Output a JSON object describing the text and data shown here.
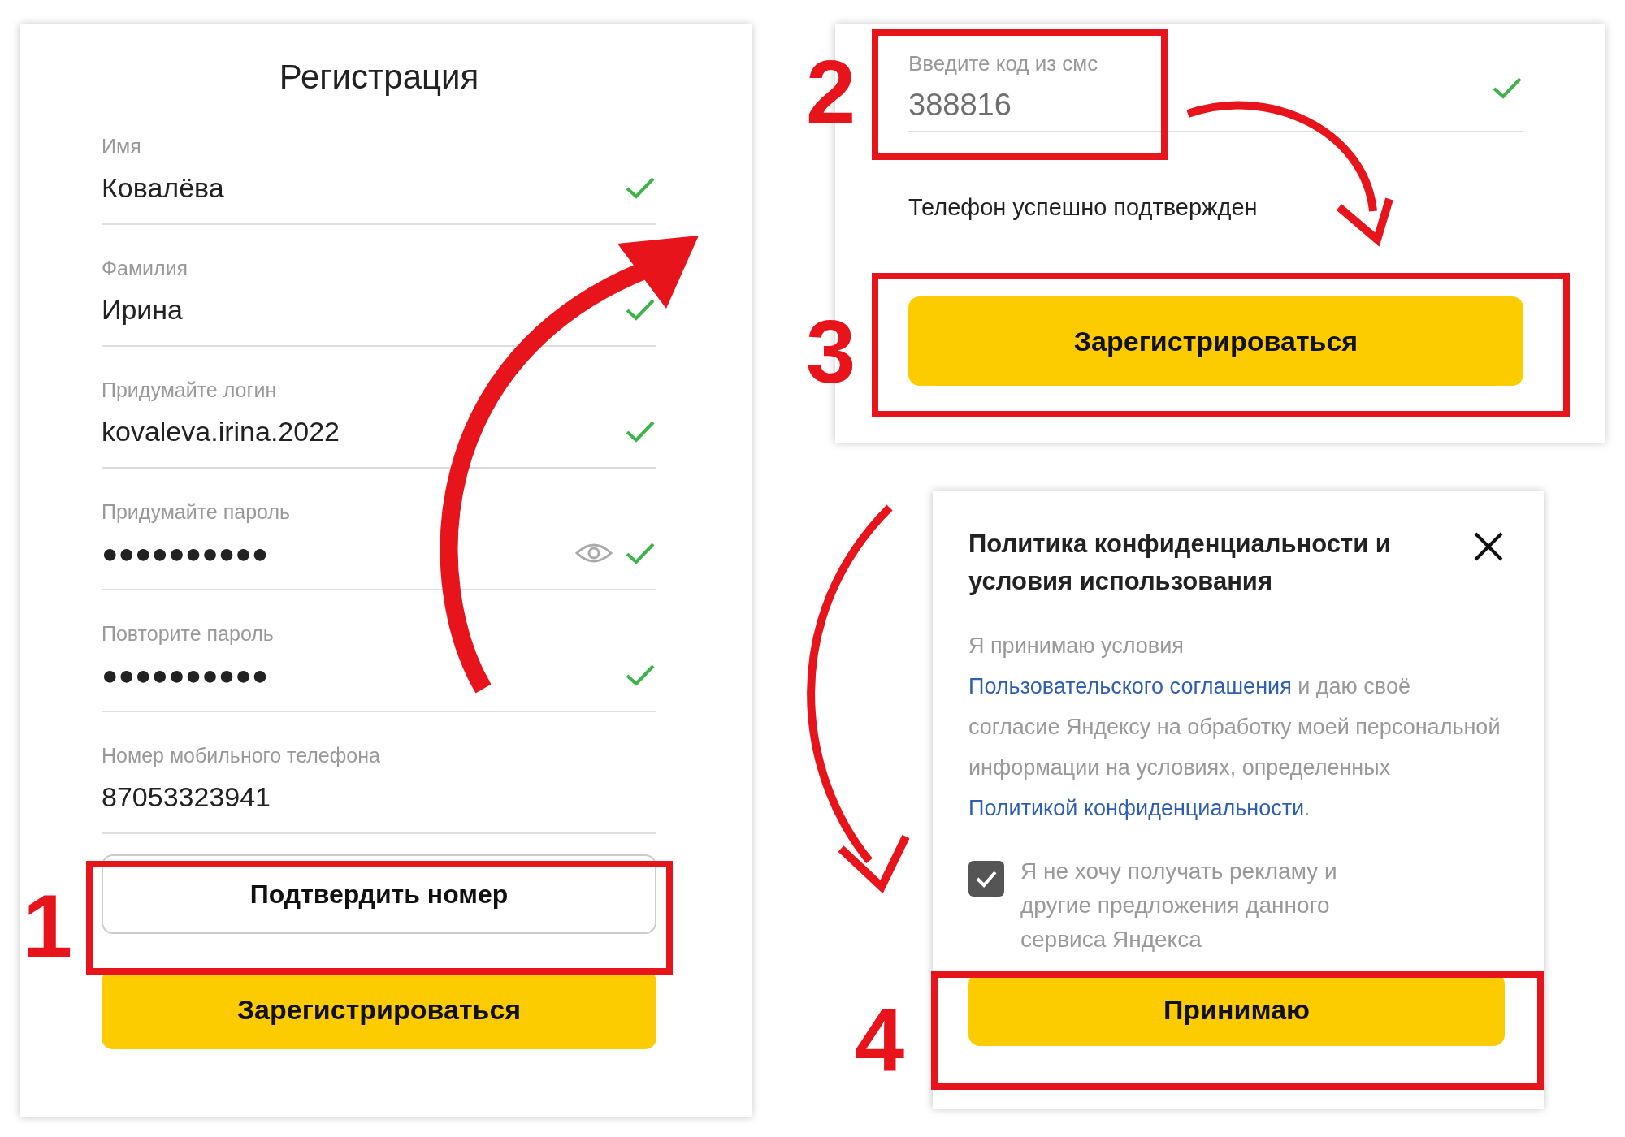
{
  "registration_form": {
    "title": "Регистрация",
    "fields": [
      {
        "label": "Имя",
        "value": "Ковалёва",
        "kind": "text",
        "valid": true
      },
      {
        "label": "Фамилия",
        "value": "Ирина",
        "kind": "text",
        "valid": true
      },
      {
        "label": "Придумайте логин",
        "value": "kovaleva.irina.2022",
        "kind": "text",
        "valid": true
      },
      {
        "label": "Придумайте пароль",
        "value": "●●●●●●●●●●",
        "kind": "password",
        "valid": true
      },
      {
        "label": "Повторите пароль",
        "value": "●●●●●●●●●●",
        "kind": "text",
        "valid": true
      },
      {
        "label": "Номер мобильного телефона",
        "value": "87053323941",
        "kind": "text",
        "valid": false
      }
    ],
    "confirm_button": "Подтвердить номер",
    "register_button": "Зарегистрироваться"
  },
  "sms_form": {
    "label": "Введите код из смс",
    "value": "388816",
    "valid": true,
    "status": "Телефон успешно подтвержден",
    "register_button": "Зарегистрироваться"
  },
  "privacy_dialog": {
    "title": "Политика конфиденциальности и условия использования",
    "text_parts": [
      {
        "kind": "plain",
        "text": "Я принимаю условия "
      },
      {
        "kind": "link",
        "text": "Пользовательского соглашения"
      },
      {
        "kind": "plain",
        "text": " и даю своё согласие Яндексу на обработку моей персональной информации на условиях, определенных "
      },
      {
        "kind": "link",
        "text": "Политикой конфиденциальности"
      },
      {
        "kind": "plain",
        "text": "."
      }
    ],
    "checkbox": {
      "label": "Я не хочу получать рекламу и другие предложения данного сервиса Яндекса",
      "checked": true
    },
    "accept_button": "Принимаю"
  },
  "step_numbers": [
    "1",
    "2",
    "3",
    "4"
  ]
}
